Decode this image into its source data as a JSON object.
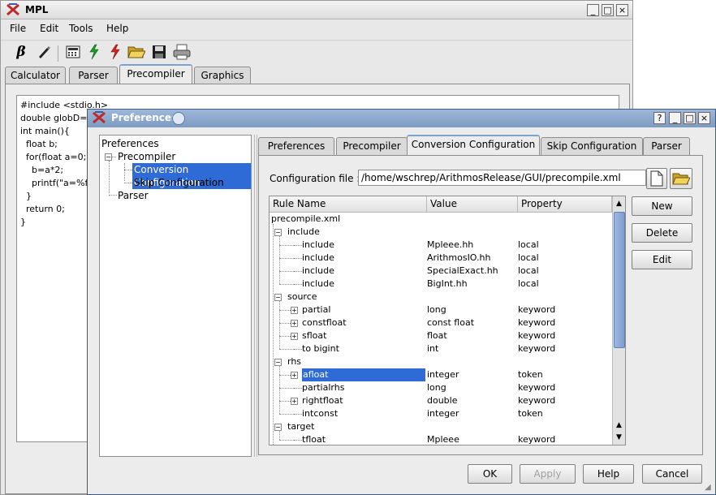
{
  "main_window": {
    "title": "MPL",
    "menu": [
      "File",
      "Edit",
      "Tools",
      "Help"
    ],
    "tabs": [
      "Calculator",
      "Parser",
      "Precompiler",
      "Graphics"
    ],
    "active_tab": "Precompiler",
    "code_lines": [
      "#include <stdio.h>",
      "",
      "double globD=",
      "",
      "int main(){",
      "  float b;",
      "  for(float a=0;a",
      "    b=a*2;",
      "    printf(\"a=%f\"",
      "  }",
      "  return 0;",
      "}"
    ],
    "toolbar_icons": [
      "beta-icon",
      "pencil-icon",
      "calculator-icon",
      "green-lightning-icon",
      "red-lightning-icon",
      "open-folder-icon",
      "save-disk-icon",
      "printer-icon"
    ],
    "beta_glyph": "β"
  },
  "dialog": {
    "title": "Preferences",
    "tree": {
      "root": "Preferences",
      "items": [
        "Precompiler",
        "Conversion Configuration",
        "Skip Configuration",
        "Parser"
      ],
      "selected": "Conversion Configuration"
    },
    "tabs": [
      "Preferences",
      "Precompiler",
      "Conversion Configuration",
      "Skip Configuration",
      "Parser"
    ],
    "active_tab": "Conversion Configuration",
    "config_label": "Configuration file :",
    "config_value": "/home/wschrep/ArithmosRelease/GUI/precompile.xml",
    "columns": [
      "Rule Name",
      "Value",
      "Property"
    ],
    "root_node": "precompile.xml",
    "groups": [
      {
        "name": "include",
        "rows": [
          {
            "name": "include",
            "value": "Mpleee.hh",
            "property": "local",
            "expandable": false
          },
          {
            "name": "include",
            "value": "ArithmosIO.hh",
            "property": "local",
            "expandable": false
          },
          {
            "name": "include",
            "value": "SpecialExact.hh",
            "property": "local",
            "expandable": false
          },
          {
            "name": "include",
            "value": "BigInt.hh",
            "property": "local",
            "expandable": false
          }
        ]
      },
      {
        "name": "source",
        "rows": [
          {
            "name": "partial",
            "value": "long",
            "property": "keyword",
            "expandable": true
          },
          {
            "name": "constfloat",
            "value": "const float",
            "property": "keyword",
            "expandable": true
          },
          {
            "name": "sfloat",
            "value": "float",
            "property": "keyword",
            "expandable": true
          },
          {
            "name": "to bigint",
            "value": "int",
            "property": "keyword",
            "expandable": false
          }
        ]
      },
      {
        "name": "rhs",
        "rows": [
          {
            "name": "afloat",
            "value": "integer",
            "property": "token",
            "expandable": true,
            "selected": true
          },
          {
            "name": "partialrhs",
            "value": "long",
            "property": "keyword",
            "expandable": false
          },
          {
            "name": "rightfloat",
            "value": "double",
            "property": "keyword",
            "expandable": true
          },
          {
            "name": "intconst",
            "value": "integer",
            "property": "token",
            "expandable": false
          }
        ]
      },
      {
        "name": "target",
        "rows": [
          {
            "name": "tfloat",
            "value": "Mpleee",
            "property": "keyword",
            "expandable": false
          }
        ]
      }
    ],
    "side_buttons": [
      "New",
      "Delete",
      "Edit"
    ],
    "bottom_buttons": [
      "OK",
      "Apply",
      "Help",
      "Cancel"
    ]
  }
}
